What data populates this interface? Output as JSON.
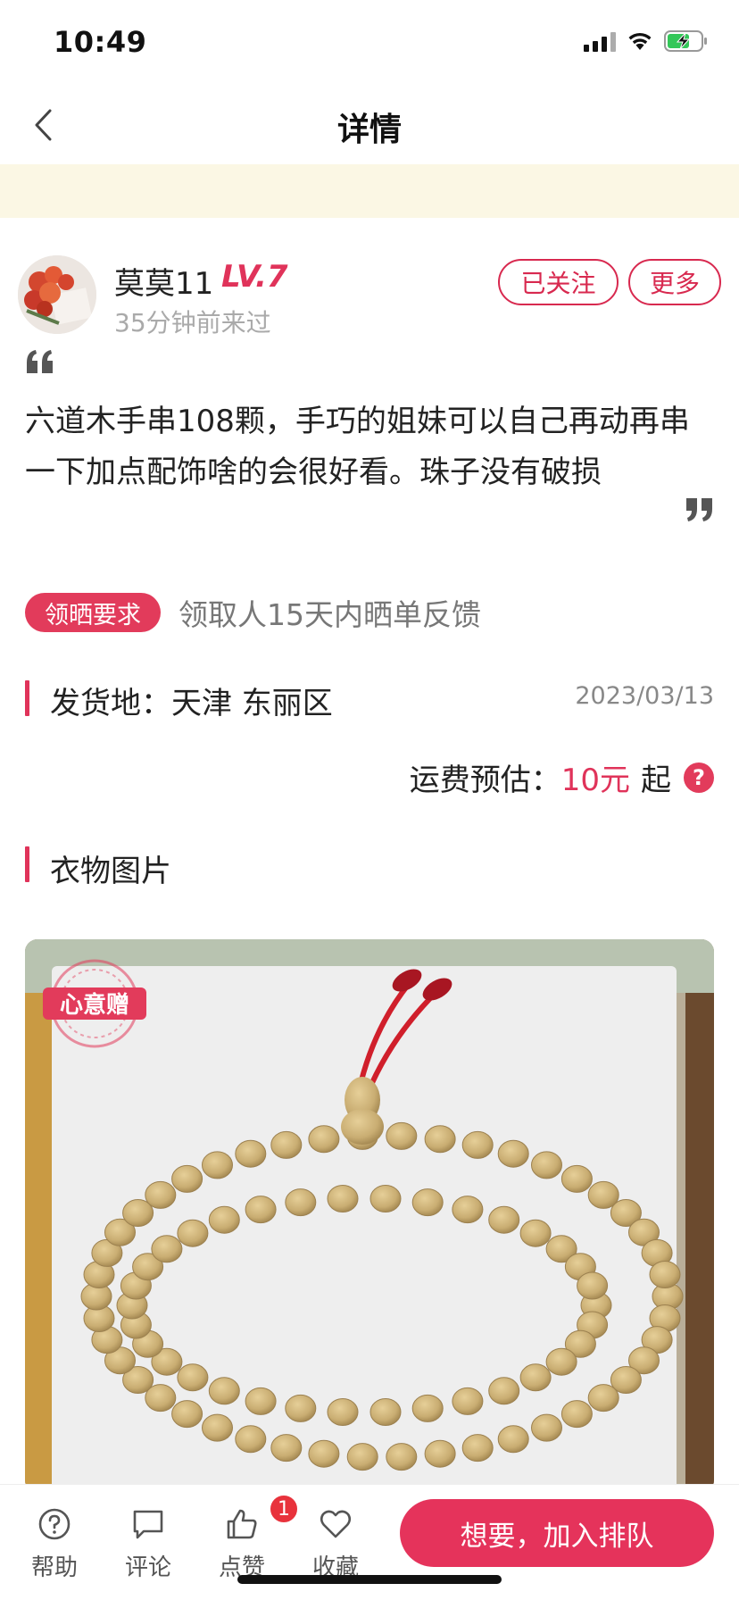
{
  "status_bar": {
    "time": "10:49"
  },
  "nav": {
    "title": "详情"
  },
  "user": {
    "name": "莫莫11",
    "level": "LV.7",
    "last_seen": "35分钟前来过",
    "follow_label": "已关注",
    "more_label": "更多"
  },
  "post": {
    "description": "六道木手串108颗，手巧的姐妹可以自己再动再串一下加点配饰啥的会很好看。珠子没有破损"
  },
  "requirement": {
    "badge": "领晒要求",
    "text": "领取人15天内晒单反馈"
  },
  "shipping": {
    "origin": "发货地：天津 东丽区",
    "date": "2023/03/13",
    "fee_label": "运费预估：",
    "fee_value": "10元",
    "fee_suffix": "起"
  },
  "photos": {
    "title": "衣物图片",
    "stamp_text": "心意赠"
  },
  "bottom_bar": {
    "tabs": [
      {
        "label": "帮助",
        "icon": "help-icon"
      },
      {
        "label": "评论",
        "icon": "comment-icon"
      },
      {
        "label": "点赞",
        "icon": "like-icon",
        "badge": "1"
      },
      {
        "label": "收藏",
        "icon": "heart-icon"
      }
    ],
    "cta_label": "想要，加入排队"
  },
  "colors": {
    "accent": "#e0335a",
    "notice_bg": "#fbf7e4"
  }
}
